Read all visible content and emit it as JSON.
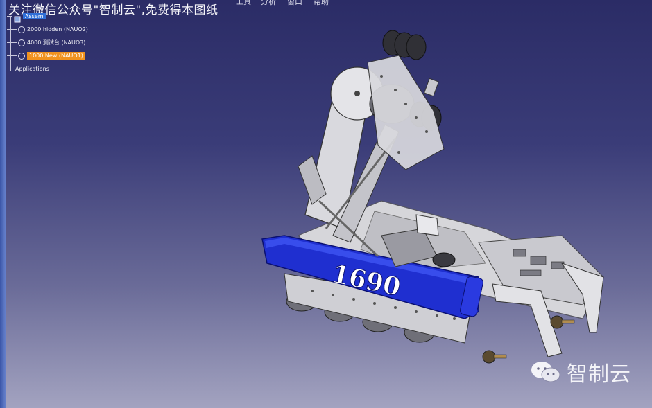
{
  "menubar": {
    "items": [
      "窗口",
      "帮助",
      "工具",
      "分析"
    ]
  },
  "watermark": {
    "top_text": "关注微信公众号\"智制云\",免费得本图纸",
    "brand_name": "智制云"
  },
  "tree": {
    "root_label": "Assem",
    "nodes": [
      {
        "label": "2000 hidden (NAUO2)",
        "icon": "part-gear-icon",
        "selected": false
      },
      {
        "label": "4000 测试台 (NAUO3)",
        "icon": "part-gear-icon",
        "selected": false
      },
      {
        "label": "1000 New (NAUO1)",
        "icon": "part-gear-icon",
        "selected": true
      }
    ],
    "applications_label": "Applications"
  },
  "model": {
    "team_number": "1690",
    "colors": {
      "bumper": "#1f2fd0",
      "frame": "#d6d6da",
      "wheel": "#707078",
      "background_top": "#2b2c66",
      "background_bottom": "#a3a3c0",
      "selection": "#f0921e"
    }
  }
}
